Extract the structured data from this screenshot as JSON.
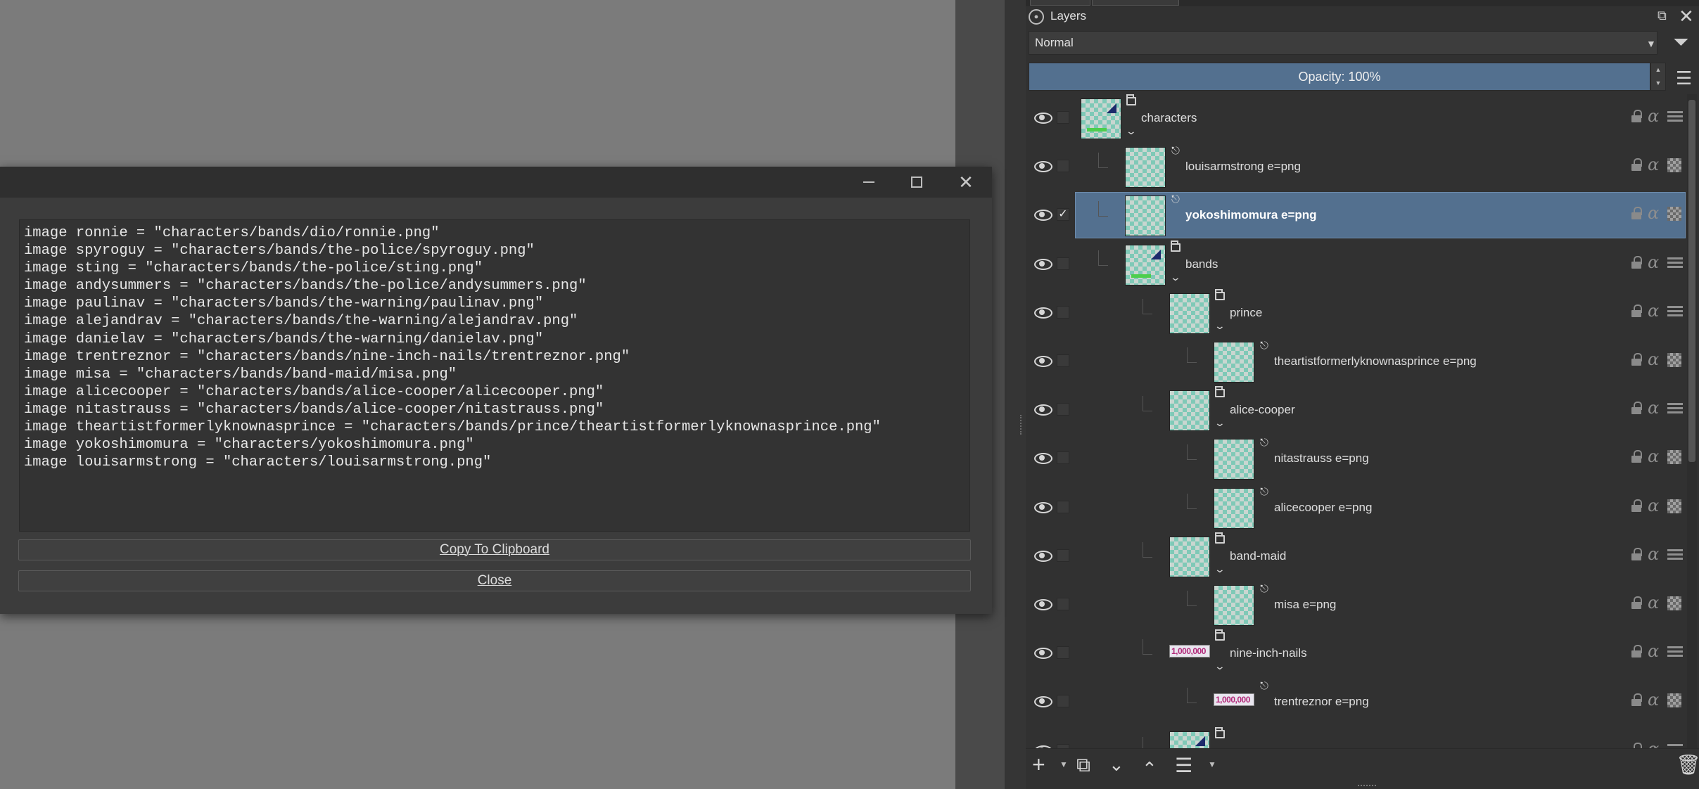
{
  "dialog": {
    "code_lines": [
      "image ronnie = \"characters/bands/dio/ronnie.png\"",
      "image spyroguy = \"characters/bands/the-police/spyroguy.png\"",
      "image sting = \"characters/bands/the-police/sting.png\"",
      "image andysummers = \"characters/bands/the-police/andysummers.png\"",
      "image paulinav = \"characters/bands/the-warning/paulinav.png\"",
      "image alejandrav = \"characters/bands/the-warning/alejandrav.png\"",
      "image danielav = \"characters/bands/the-warning/danielav.png\"",
      "image trentreznor = \"characters/bands/nine-inch-nails/trentreznor.png\"",
      "image misa = \"characters/bands/band-maid/misa.png\"",
      "image alicecooper = \"characters/bands/alice-cooper/alicecooper.png\"",
      "image nitastrauss = \"characters/bands/alice-cooper/nitastrauss.png\"",
      "image theartistformerlyknownasprince = \"characters/bands/prince/theartistformerlyknownasprince.png\"",
      "image yokoshimomura = \"characters/yokoshimomura.png\"",
      "image louisarmstrong = \"characters/louisarmstrong.png\""
    ],
    "copy_button": "Copy To Clipboard",
    "close_button": "Close"
  },
  "layers_panel": {
    "title": "Layers",
    "blend_mode": "Normal",
    "opacity": "Opacity:  100%",
    "colors": {
      "selected_row": "#53708f",
      "panel_bg": "#313131"
    },
    "layers": [
      {
        "name": "characters",
        "type": "group",
        "depth": 0,
        "thumb": "art",
        "expanded": true,
        "checked": false,
        "selected": false
      },
      {
        "name": "louisarmstrong e=png",
        "type": "paint",
        "depth": 1,
        "thumb": "checker",
        "checked": false,
        "selected": false
      },
      {
        "name": "yokoshimomura e=png",
        "type": "paint",
        "depth": 1,
        "thumb": "checker",
        "checked": true,
        "selected": true
      },
      {
        "name": "bands",
        "type": "group",
        "depth": 1,
        "thumb": "art",
        "expanded": true,
        "checked": false,
        "selected": false
      },
      {
        "name": "prince",
        "type": "group",
        "depth": 2,
        "thumb": "checker",
        "expanded": true,
        "checked": false,
        "selected": false
      },
      {
        "name": "theartistformerlyknownasprince e=png",
        "type": "paint",
        "depth": 3,
        "thumb": "checker",
        "checked": false,
        "selected": false
      },
      {
        "name": "alice-cooper",
        "type": "group",
        "depth": 2,
        "thumb": "checker",
        "expanded": true,
        "checked": false,
        "selected": false
      },
      {
        "name": "nitastrauss e=png",
        "type": "paint",
        "depth": 3,
        "thumb": "checker",
        "checked": false,
        "selected": false
      },
      {
        "name": "alicecooper e=png",
        "type": "paint",
        "depth": 3,
        "thumb": "checker",
        "checked": false,
        "selected": false
      },
      {
        "name": "band-maid",
        "type": "group",
        "depth": 2,
        "thumb": "checker",
        "expanded": true,
        "checked": false,
        "selected": false
      },
      {
        "name": "misa e=png",
        "type": "paint",
        "depth": 3,
        "thumb": "checker",
        "checked": false,
        "selected": false
      },
      {
        "name": "nine-inch-nails",
        "type": "group",
        "depth": 2,
        "thumb": "wide",
        "expanded": true,
        "checked": false,
        "selected": false
      },
      {
        "name": "trentreznor e=png",
        "type": "paint",
        "depth": 3,
        "thumb": "wide",
        "checked": false,
        "selected": false
      },
      {
        "name": "",
        "type": "group",
        "depth": 2,
        "thumb": "art",
        "expanded": false,
        "checked": false,
        "selected": false
      }
    ],
    "wide_thumb_text": "1,000,000"
  },
  "toolbar": {
    "icons": [
      "add-layer-icon",
      "duplicate-layer-icon",
      "move-down-icon",
      "move-up-icon",
      "layer-properties-icon",
      "delete-layer-icon"
    ]
  }
}
